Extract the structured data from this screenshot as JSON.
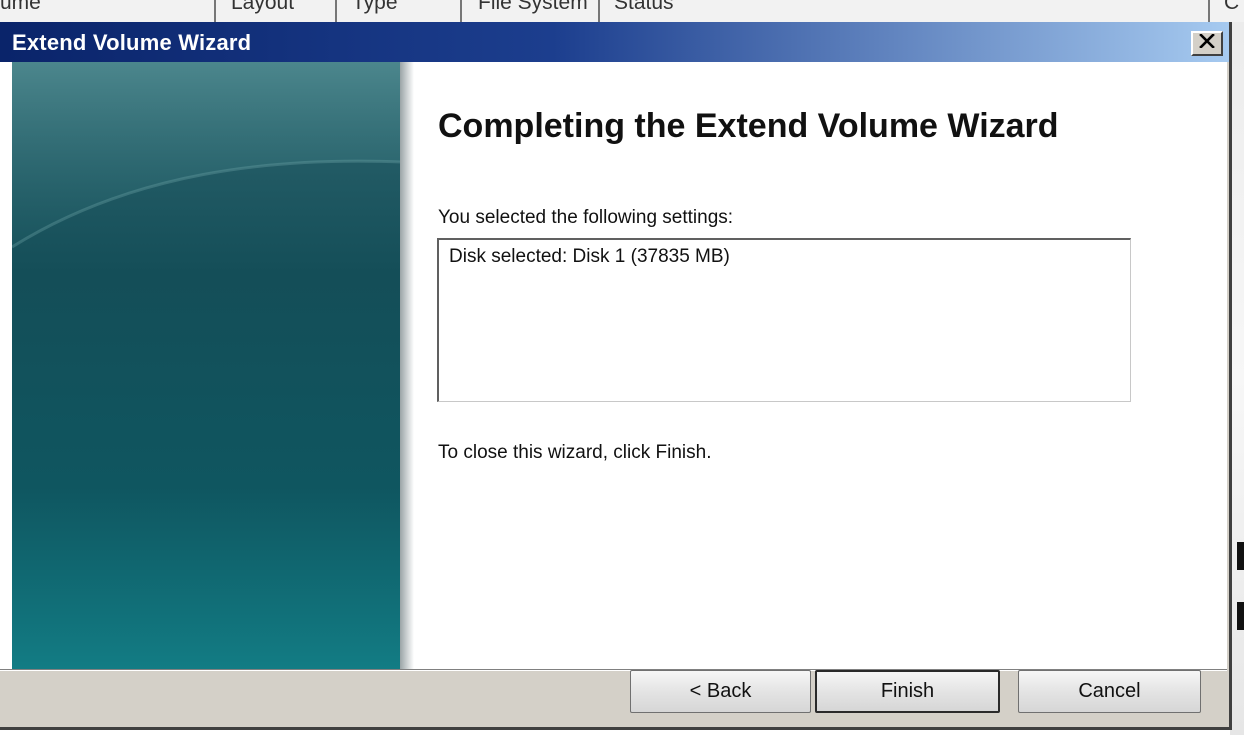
{
  "background_window": {
    "columns": [
      "ume",
      "Layout",
      "Type",
      "File System",
      "Status",
      "C"
    ]
  },
  "wizard": {
    "title": "Extend Volume Wizard",
    "heading": "Completing the Extend Volume Wizard",
    "settings_label": "You selected the following settings:",
    "settings": [
      "Disk selected: Disk 1 (37835 MB)"
    ],
    "close_hint": "To close this wizard, click Finish.",
    "buttons": {
      "back": "< Back",
      "finish": "Finish",
      "cancel": "Cancel"
    },
    "icons": {
      "close": "close-icon"
    }
  },
  "colors": {
    "titlebar_start": "#0a246a",
    "titlebar_end": "#a6caf0",
    "side_panel": "#144e58",
    "dialog_face": "#d4d0c8"
  }
}
